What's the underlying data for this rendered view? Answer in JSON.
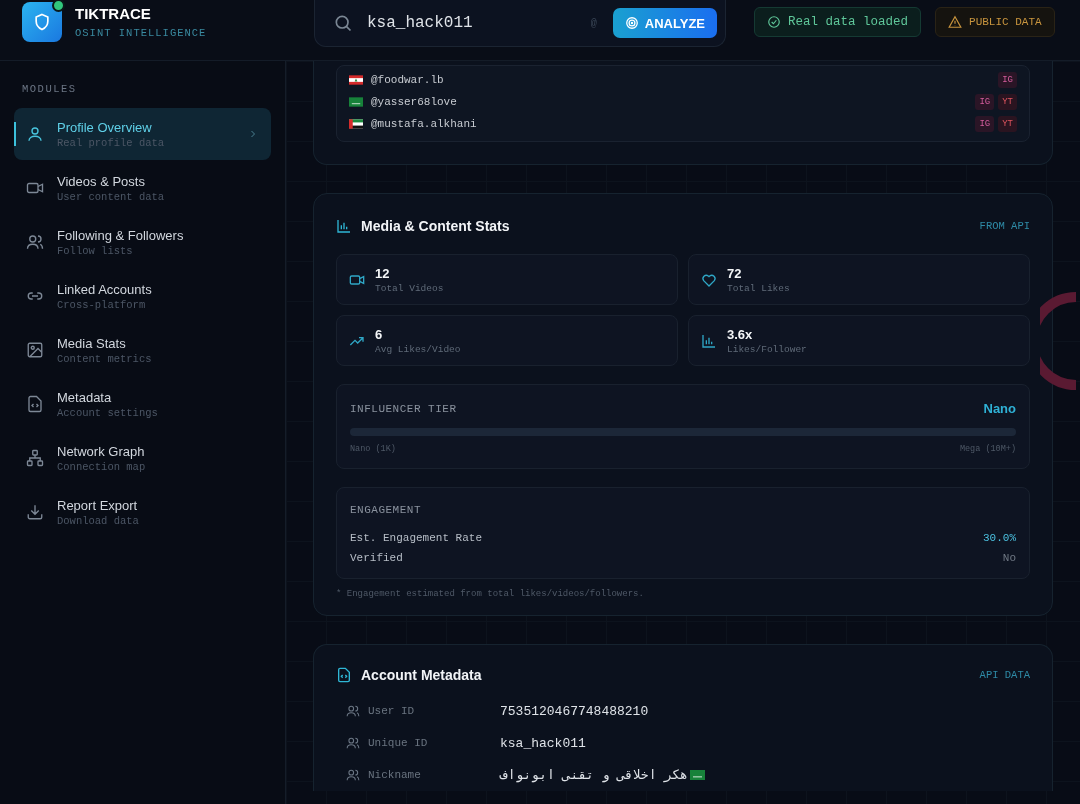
{
  "brand": {
    "name": "TIKTRACE",
    "tagline": "OSINT INTELLIGENCE",
    "online": true
  },
  "search": {
    "value": "ksa_hack011",
    "hint_symbol": "@",
    "button": "ANALYZE"
  },
  "status_badges": [
    {
      "kind": "ok",
      "label": "Real data loaded"
    },
    {
      "kind": "warn",
      "label": "PUBLIC DATA"
    }
  ],
  "sidebar": {
    "heading": "MODULES",
    "items": [
      {
        "title": "Profile Overview",
        "subtitle": "Real profile data",
        "selected": true
      },
      {
        "title": "Videos & Posts",
        "subtitle": "User content data",
        "selected": false
      },
      {
        "title": "Following & Followers",
        "subtitle": "Follow lists",
        "selected": false
      },
      {
        "title": "Linked Accounts",
        "subtitle": "Cross-platform",
        "selected": false
      },
      {
        "title": "Media Stats",
        "subtitle": "Content metrics",
        "selected": false
      },
      {
        "title": "Metadata",
        "subtitle": "Account settings",
        "selected": false
      },
      {
        "title": "Network Graph",
        "subtitle": "Connection map",
        "selected": false
      },
      {
        "title": "Report Export",
        "subtitle": "Download data",
        "selected": false
      }
    ]
  },
  "linked_accounts": [
    {
      "handle": "@foodwar.lb",
      "platforms": [
        "IG"
      ]
    },
    {
      "handle": "@yasser68love",
      "platforms": [
        "IG",
        "YT"
      ]
    },
    {
      "handle": "@mustafa.alkhani",
      "platforms": [
        "IG",
        "YT"
      ]
    }
  ],
  "media_stats": {
    "title": "Media & Content Stats",
    "source": "FROM API",
    "stats": [
      {
        "value": "12",
        "label": "Total Videos"
      },
      {
        "value": "72",
        "label": "Total Likes"
      },
      {
        "value": "6",
        "label": "Avg Likes/Video"
      },
      {
        "value": "3.6x",
        "label": "Likes/Follower"
      }
    ],
    "tier": {
      "heading": "INFLUENCER TIER",
      "value": "Nano",
      "level": 0,
      "min_label": "Nano (1K)",
      "max_label": "Mega (10M+)"
    },
    "engagement": {
      "heading": "ENGAGEMENT",
      "rows": [
        {
          "label": "Est. Engagement Rate",
          "value": "30.0%",
          "highlight": true
        },
        {
          "label": "Verified",
          "value": "No",
          "highlight": false
        }
      ]
    },
    "footnote": "* Engagement estimated from total likes/videos/followers."
  },
  "metadata": {
    "title": "Account Metadata",
    "source": "API DATA",
    "rows": [
      {
        "label": "User ID",
        "value": "7535120467748488210"
      },
      {
        "label": "Unique ID",
        "value": "ksa_hack011"
      },
      {
        "label": "Nickname",
        "value": "هکر اخلاقی و تقنی ابونواف"
      }
    ]
  }
}
